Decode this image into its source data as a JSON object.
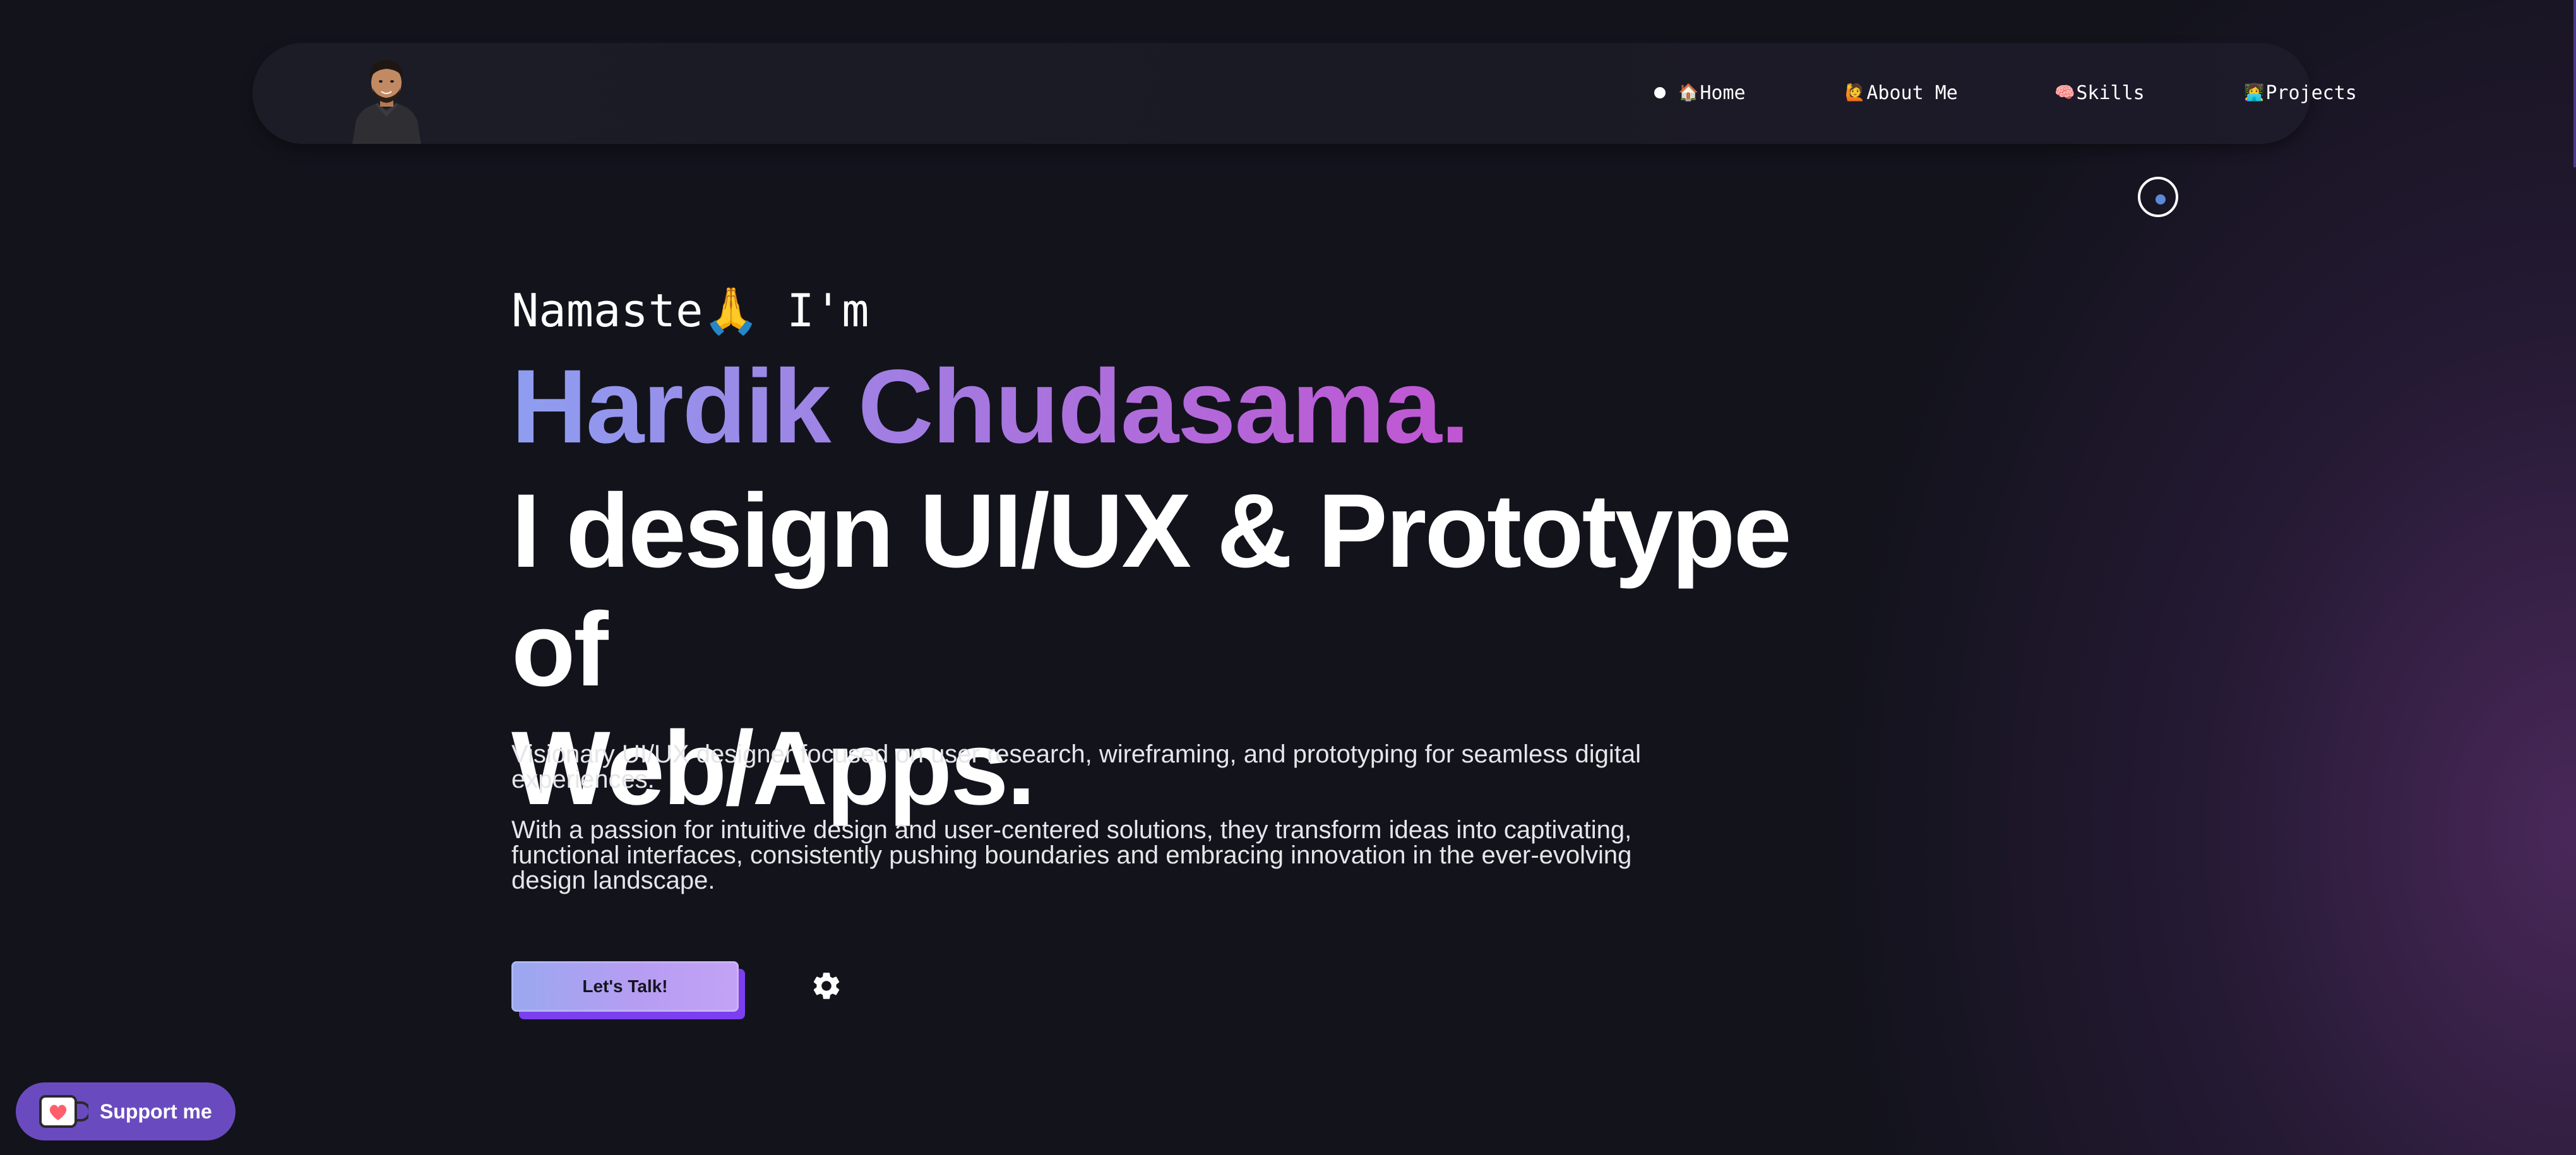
{
  "nav": {
    "items": [
      {
        "emoji": "🏠",
        "label": "Home"
      },
      {
        "emoji": "🙋",
        "label": "About Me"
      },
      {
        "emoji": "🧠",
        "label": "Skills"
      },
      {
        "emoji": "👩‍💻",
        "label": "Projects"
      }
    ]
  },
  "hero": {
    "greeting": "Namaste🙏 I'm",
    "name": "Hardik Chudasama.",
    "headline_line1": "I design UI/UX & Prototype of",
    "headline_line2": "Web/Apps.",
    "para1": "Visionary UI/UX designer focused on user research, wireframing, and prototyping for seamless digital experiences.",
    "para2": "With a passion for intuitive design and user-centered solutions, they transform ideas into captivating, functional interfaces, consistently pushing boundaries and embracing innovation in the ever-evolving design landscape.",
    "cta_label": "Let's Talk!"
  },
  "support": {
    "label": "Support me"
  },
  "icons": {
    "settings": "gear-icon",
    "support": "coffee-mug-heart-icon",
    "cursor": "cursor-ring-icon"
  },
  "colors": {
    "background": "#13131c",
    "name_gradient_start": "#8e9ef0",
    "name_gradient_end": "#c155d2",
    "cta_shadow": "#7b3ff0",
    "support_bg": "#6a4bbf"
  }
}
